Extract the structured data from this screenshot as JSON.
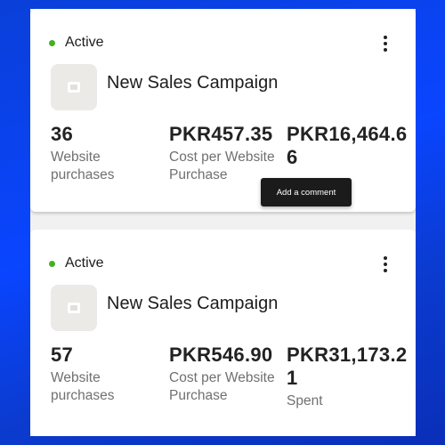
{
  "colors": {
    "active_dot": "#45b020",
    "background": "#0a45ff"
  },
  "icons": {
    "more": "more-vertical-icon",
    "thumbnail": "image-placeholder-icon"
  },
  "campaigns": [
    {
      "status": "Active",
      "name": "New Sales Campaign",
      "metrics": [
        {
          "value": "36",
          "label": "Website purchases"
        },
        {
          "value": "PKR457.35",
          "label": "Cost per Website Purchase"
        },
        {
          "value": "PKR16,464.66",
          "label": ""
        }
      ]
    },
    {
      "status": "Active",
      "name": "New Sales Campaign",
      "metrics": [
        {
          "value": "57",
          "label": "Website purchases"
        },
        {
          "value": "PKR546.90",
          "label": "Cost per Website Purchase"
        },
        {
          "value": "PKR31,173.21",
          "label": "Spent"
        }
      ]
    }
  ],
  "tooltip": {
    "text": "Add a comment"
  }
}
